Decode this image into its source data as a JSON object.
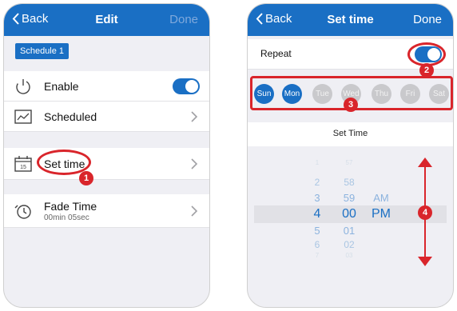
{
  "left_screen": {
    "nav": {
      "back_label": "Back",
      "title": "Edit",
      "done_label": "Done"
    },
    "schedule_tab": "Schedule 1",
    "rows": {
      "enable": "Enable",
      "scheduled": "Scheduled",
      "set_time": "Set time",
      "fade_time": "Fade Time",
      "fade_time_value": "00min 05sec"
    },
    "enable_toggle_on": true,
    "callout": "1"
  },
  "right_screen": {
    "nav": {
      "back_label": "Back",
      "title": "Set time",
      "done_label": "Done"
    },
    "repeat_label": "Repeat",
    "repeat_toggle_on": true,
    "days": [
      {
        "label": "Sun",
        "selected": true
      },
      {
        "label": "Mon",
        "selected": true
      },
      {
        "label": "Tue",
        "selected": false
      },
      {
        "label": "Wed",
        "selected": false
      },
      {
        "label": "Thu",
        "selected": false
      },
      {
        "label": "Fri",
        "selected": false
      },
      {
        "label": "Sat",
        "selected": false
      }
    ],
    "set_time_label": "Set Time",
    "picker": {
      "hours": [
        "1",
        "2",
        "3",
        "4",
        "5",
        "6",
        "7"
      ],
      "minutes": [
        "57",
        "58",
        "59",
        "00",
        "01",
        "02",
        "03"
      ],
      "ampm": [
        "AM",
        "PM"
      ],
      "selected_hour": "4",
      "selected_minute": "00",
      "selected_ampm": "PM"
    },
    "callouts": [
      "2",
      "3",
      "4"
    ]
  },
  "colors": {
    "brand_blue": "#1a6fc4",
    "callout_red": "#d9252b",
    "background": "#efeff4",
    "day_off": "#c9c9cc"
  }
}
